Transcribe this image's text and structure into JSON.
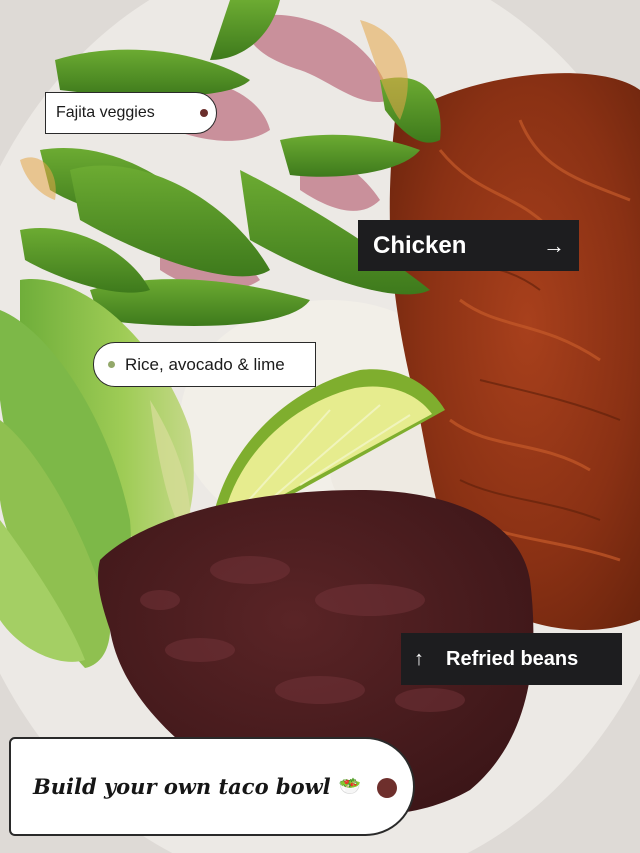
{
  "labels": {
    "fajita": "Fajita veggies",
    "chicken": "Chicken",
    "rice": "Rice, avocado & lime",
    "beans": "Refried beans",
    "title": "Build your own taco bowl"
  },
  "icons": {
    "chicken_arrow": "arrow-right-icon",
    "beans_arrow": "arrow-up-icon",
    "title_emoji": "bowl-icon"
  },
  "colors": {
    "tag_dark": "#1d1d1f",
    "tag_light": "#ffffff",
    "bean_dot": "#6e2f2c"
  }
}
